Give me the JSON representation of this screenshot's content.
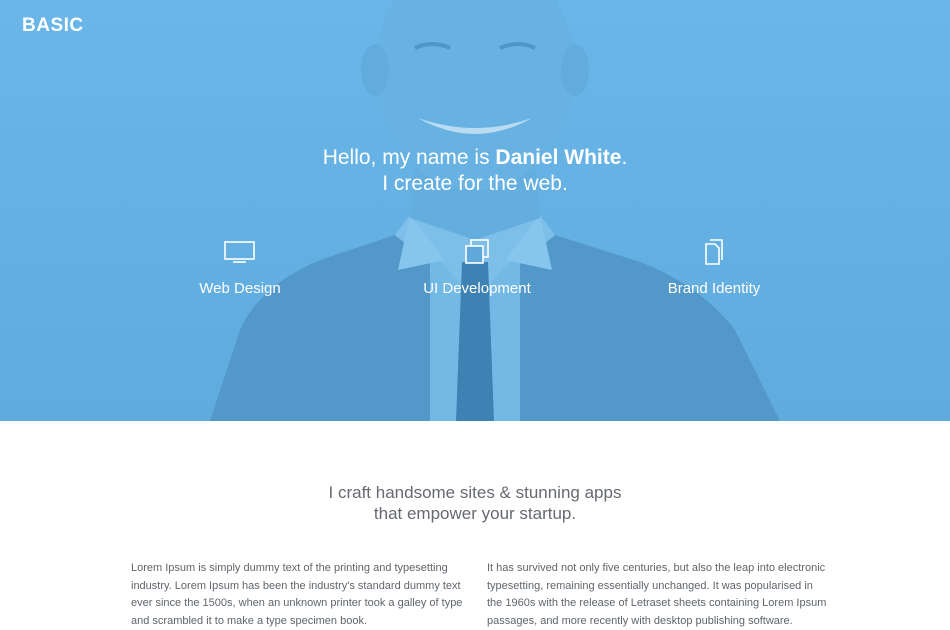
{
  "brand": "BASIC",
  "colors": {
    "hero_background": "#67b4e6",
    "text_white": "#ffffff",
    "body_text": "#5f656b"
  },
  "hero": {
    "greeting": "Hello, my name is ",
    "name": "Daniel White",
    "greeting_end": ".",
    "subtitle": "I create for the web."
  },
  "services": [
    {
      "label": "Web Design",
      "icon": "monitor-icon"
    },
    {
      "label": "UI Development",
      "icon": "stacked-windows-icon"
    },
    {
      "label": "Brand Identity",
      "icon": "document-pages-icon"
    }
  ],
  "tagline": {
    "line1": "I craft handsome sites & stunning apps",
    "line2": "that empower your startup."
  },
  "columns": [
    "Lorem Ipsum is simply dummy text of the printing and typesetting industry. Lorem Ipsum has been the industry's standard dummy text ever since the 1500s, when an unknown printer took a galley of type and scrambled it to make a type specimen book.",
    "It has survived not only five centuries, but also the leap into electronic typesetting, remaining essentially unchanged. It was popularised in the 1960s with the release of Letraset sheets containing Lorem Ipsum passages, and more recently with desktop publishing software."
  ]
}
